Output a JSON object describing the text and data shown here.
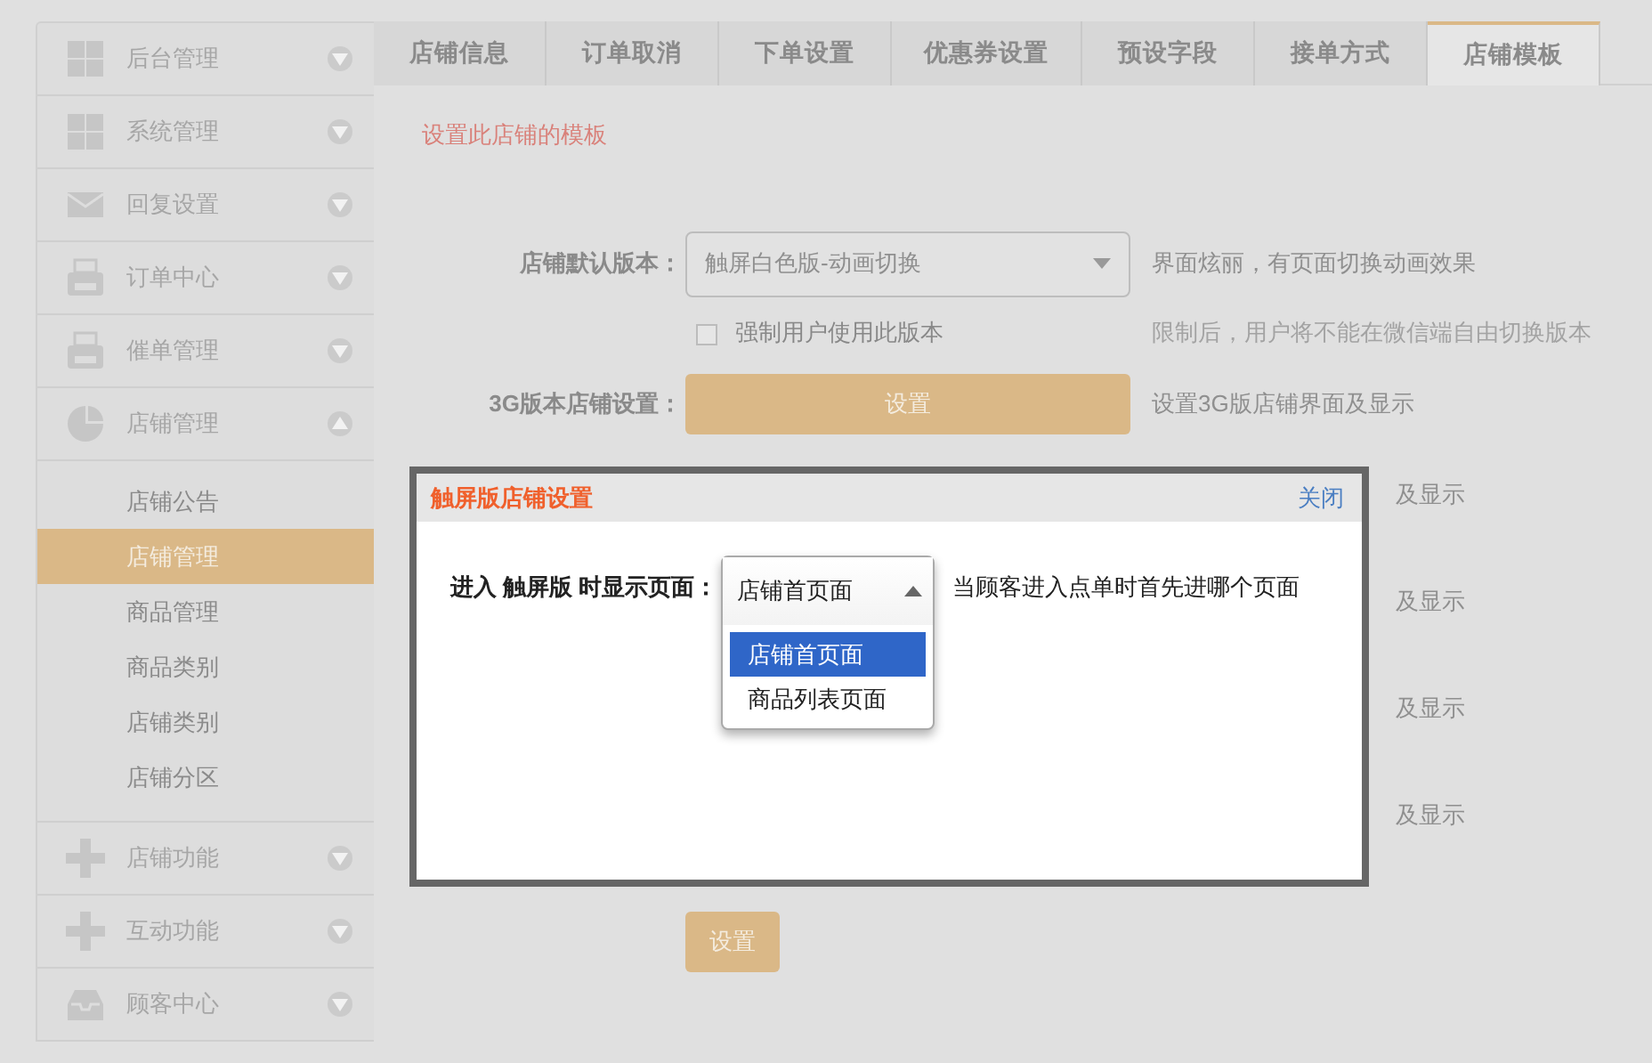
{
  "sidebar": {
    "items": [
      {
        "label": "后台管理",
        "kind": "grid",
        "expanded": false
      },
      {
        "label": "系统管理",
        "kind": "grid",
        "expanded": false
      },
      {
        "label": "回复设置",
        "kind": "envelope",
        "expanded": false
      },
      {
        "label": "订单中心",
        "kind": "printer",
        "expanded": false
      },
      {
        "label": "催单管理",
        "kind": "printer",
        "expanded": false
      },
      {
        "label": "店铺管理",
        "kind": "pie",
        "expanded": true,
        "children": [
          {
            "label": "店铺公告",
            "selected": false
          },
          {
            "label": "店铺管理",
            "selected": true
          },
          {
            "label": "商品管理",
            "selected": false
          },
          {
            "label": "商品类别",
            "selected": false
          },
          {
            "label": "店铺类别",
            "selected": false
          },
          {
            "label": "店铺分区",
            "selected": false
          }
        ]
      },
      {
        "label": "店铺功能",
        "kind": "plus",
        "expanded": false
      },
      {
        "label": "互动功能",
        "kind": "plus",
        "expanded": false
      },
      {
        "label": "顾客中心",
        "kind": "inbox",
        "expanded": false
      }
    ]
  },
  "tabs": [
    {
      "label": "店铺信息",
      "selected": false
    },
    {
      "label": "订单取消",
      "selected": false
    },
    {
      "label": "下单设置",
      "selected": false
    },
    {
      "label": "优惠券设置",
      "selected": false
    },
    {
      "label": "预设字段",
      "selected": false
    },
    {
      "label": "接单方式",
      "selected": false
    },
    {
      "label": "店铺模板",
      "selected": true
    }
  ],
  "note": "设置此店铺的模板",
  "form": [
    {
      "kind": "select",
      "label": "店铺默认版本：",
      "value": "触屏白色版-动画切换",
      "help": "界面炫丽，有页面切换动画效果"
    },
    {
      "kind": "checkbox",
      "label": "强制用户使用此版本",
      "checked": false,
      "help": "限制后，用户将不能在微信端自由切换版本"
    },
    {
      "kind": "button",
      "label": "3G版本店铺设置：",
      "button": "设置",
      "help": "设置3G版店铺界面及显示"
    },
    {
      "kind": "covered",
      "help": "及显示"
    },
    {
      "kind": "covered",
      "help": "及显示"
    },
    {
      "kind": "covered",
      "help": "及显示"
    },
    {
      "kind": "covered",
      "help": "及显示"
    },
    {
      "kind": "submit",
      "button": "设置"
    }
  ],
  "modal": {
    "title": "触屏版店铺设置",
    "close": "关闭",
    "label": "进入 触屏版 时显示页面：",
    "value": "店铺首页面",
    "expanded": true,
    "options": [
      {
        "label": "店铺首页面",
        "selected": true
      },
      {
        "label": "商品列表页面",
        "selected": false
      }
    ],
    "help": "当顾客进入点单时首先进哪个页面"
  }
}
